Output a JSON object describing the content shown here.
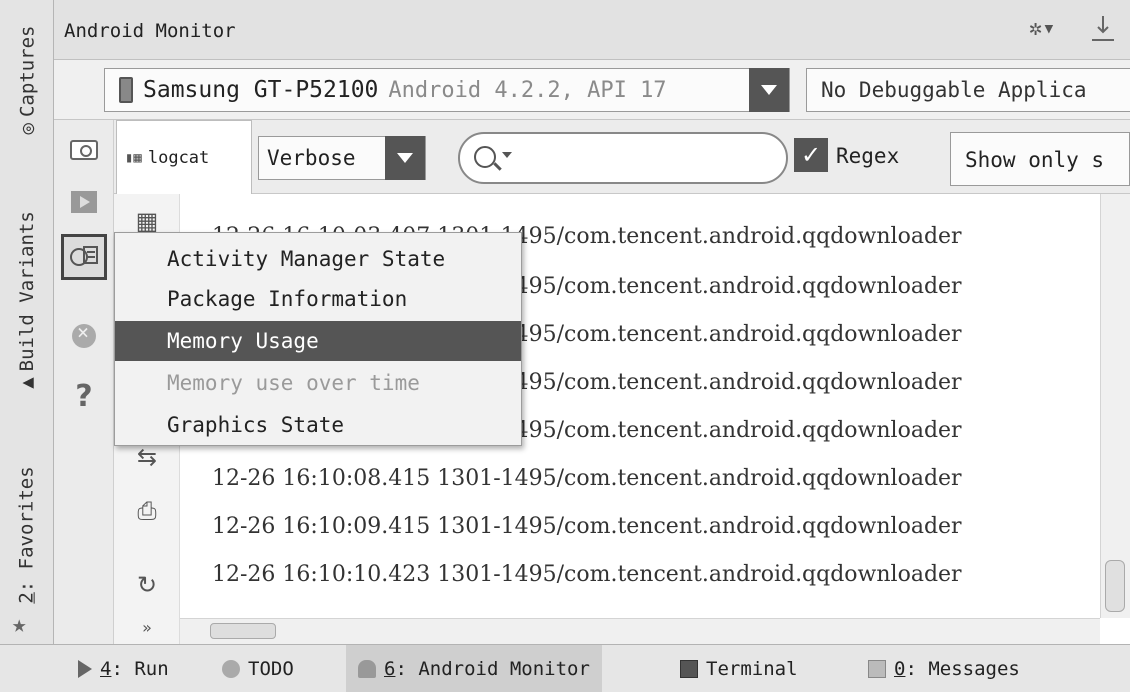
{
  "side_tabs": {
    "captures": "Captures",
    "build_variants": "Build Variants",
    "favorites_num": "2",
    "favorites": ": Favorites"
  },
  "header": {
    "title": "Android Monitor"
  },
  "device": {
    "name": "Samsung GT-P52100",
    "api": "Android 4.2.2, API 17"
  },
  "app_select": {
    "value": "No Debuggable Applica"
  },
  "logcat": {
    "tab_label": "logcat",
    "level": "Verbose",
    "search_placeholder": "",
    "regex_checked": true,
    "regex_label": "Regex",
    "filter": "Show only s"
  },
  "log_lines": [
    "12-26 16:10:03.407 1301-1495/com.tencent.android.qqdownloader",
    "12-26 16:10:04.411 1301-1495/com.tencent.android.qqdownloader",
    "12-26 16:10:05.411 1301-1495/com.tencent.android.qqdownloader",
    "12-26 16:10:06.415 1301-1495/com.tencent.android.qqdownloader",
    "12-26 16:10:07.415 1301-1495/com.tencent.android.qqdownloader",
    "12-26 16:10:08.415 1301-1495/com.tencent.android.qqdownloader",
    "12-26 16:10:09.415 1301-1495/com.tencent.android.qqdownloader",
    "12-26 16:10:10.423 1301-1495/com.tencent.android.qqdownloader"
  ],
  "popup_menu": {
    "items": [
      {
        "label": "Activity Manager State",
        "state": "normal"
      },
      {
        "label": "Package Information",
        "state": "normal"
      },
      {
        "label": "Memory Usage",
        "state": "selected"
      },
      {
        "label": "Memory use over time",
        "state": "disabled"
      },
      {
        "label": "Graphics State",
        "state": "normal"
      }
    ]
  },
  "bottom_tabs": {
    "run_num": "4",
    "run": ": Run",
    "todo": "TODO",
    "monitor_num": "6",
    "monitor": ": Android Monitor",
    "terminal": "Terminal",
    "messages_num": "0",
    "messages": ": Messages"
  },
  "colors": {
    "selected_bg": "#555555",
    "panel_bg": "#e4e4e4"
  }
}
